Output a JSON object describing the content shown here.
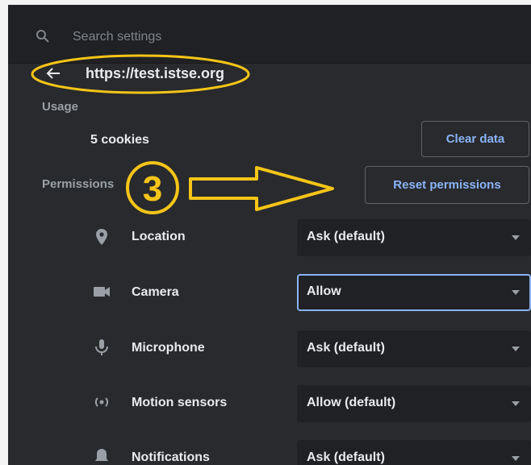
{
  "search": {
    "placeholder": "Search settings"
  },
  "site": {
    "url": "https://test.istse.org"
  },
  "usage": {
    "heading": "Usage",
    "cookies": "5 cookies",
    "clear_label": "Clear data"
  },
  "permissions": {
    "heading": "Permissions",
    "reset_label": "Reset permissions",
    "items": [
      {
        "label": "Location",
        "value": "Ask (default)",
        "icon": "location-pin-icon"
      },
      {
        "label": "Camera",
        "value": "Allow",
        "icon": "camera-icon"
      },
      {
        "label": "Microphone",
        "value": "Ask (default)",
        "icon": "microphone-icon"
      },
      {
        "label": "Motion sensors",
        "value": "Allow (default)",
        "icon": "motion-sensors-icon"
      },
      {
        "label": "Notifications",
        "value": "Ask (default)",
        "icon": "notifications-bell-icon"
      }
    ]
  },
  "annotation": {
    "step_number": "3",
    "color": "#f5c518"
  },
  "colors": {
    "background": "#292a2d",
    "accent": "#8ab4f8",
    "text": "#e8eaed",
    "muted": "#9aa0a6"
  }
}
